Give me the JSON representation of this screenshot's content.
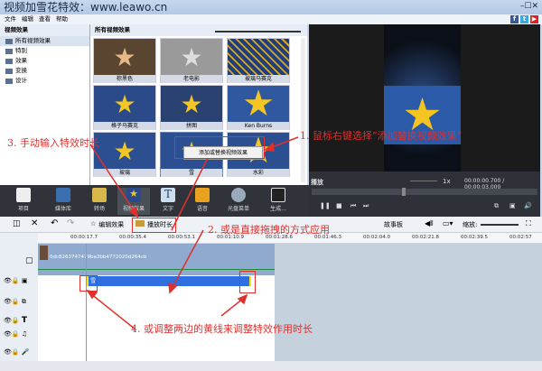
{
  "title": "视频加雪花特效：www.leawo.cn",
  "window_controls": "–☐✕",
  "menu": [
    "文件",
    "编辑",
    "查看",
    "帮助"
  ],
  "social": [
    "f",
    "t",
    "▶"
  ],
  "left_panel": {
    "header": "视频效果",
    "items": [
      "所有视频效果",
      "特别",
      "效果",
      "变换",
      "设计"
    ]
  },
  "effects_panel": {
    "header": "所有视频效果",
    "items": [
      "棕黑色",
      "老电影",
      "玻璃马赛克",
      "格子马赛克",
      "拼图",
      "Ken Burns",
      "玻璃",
      "雪",
      "水彩"
    ]
  },
  "context_menu": "添加或替换视频效果",
  "playback": {
    "label": "播放",
    "speed": "1x",
    "time": "00:00:00.700 / 00:00:03.000",
    "progress": 0.4
  },
  "toolbar": [
    "项目",
    "媒体库",
    "转场",
    "视频效果",
    "文字",
    "语音",
    "光盘菜单",
    "生成..."
  ],
  "timeline_toolbar": {
    "edit_effect": "编辑效果",
    "duration": "播放时长",
    "storyboard": "故事板",
    "zoom_label": "缩放:"
  },
  "ruler": [
    "00:00:17.7",
    "00:00:35.4",
    "00:00:53.1",
    "00:01:10.9",
    "00:01:28.6",
    "00:01:46.3",
    "00:02:04.0",
    "00:02:21.8",
    "00:02:39.5",
    "00:02:57"
  ],
  "clip_name": "0dc8263747479ba3bb4772020d264cb",
  "effect_clip": "雪",
  "annotations": {
    "a1": "1. 鼠标右键选择“添加替换视频效果”",
    "a2": "2. 或是直接拖拽的方式应用",
    "a3": "3. 手动输入特效时长",
    "a4": "4. 或调整两边的黄线来调整特效作用时长"
  },
  "colors": {
    "annotation": "#e0302c",
    "effect_bar": "#2f6fe0",
    "handle": "#f5e21b"
  }
}
